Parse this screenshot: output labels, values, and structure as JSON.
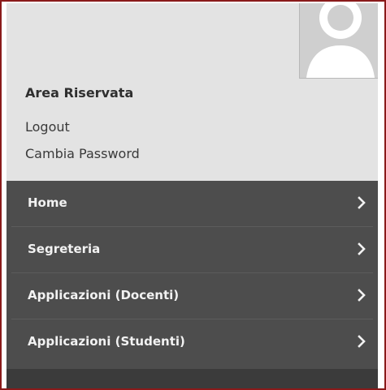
{
  "header": {
    "title": "Area Riservata",
    "logout_label": "Logout",
    "change_password_label": "Cambia Password"
  },
  "menu": {
    "items": [
      {
        "label": "Home",
        "icon": "chevron-right-icon"
      },
      {
        "label": "Segreteria",
        "icon": "chevron-right-icon"
      },
      {
        "label": "Applicazioni (Docenti)",
        "icon": "chevron-right-icon"
      },
      {
        "label": "Applicazioni (Studenti)",
        "icon": "chevron-right-icon"
      }
    ]
  },
  "colors": {
    "header_bg": "#e3e3e3",
    "menu_bg": "#4d4d4d",
    "menu_text": "#f2f2f2",
    "border_accent": "#8a1a1a"
  }
}
